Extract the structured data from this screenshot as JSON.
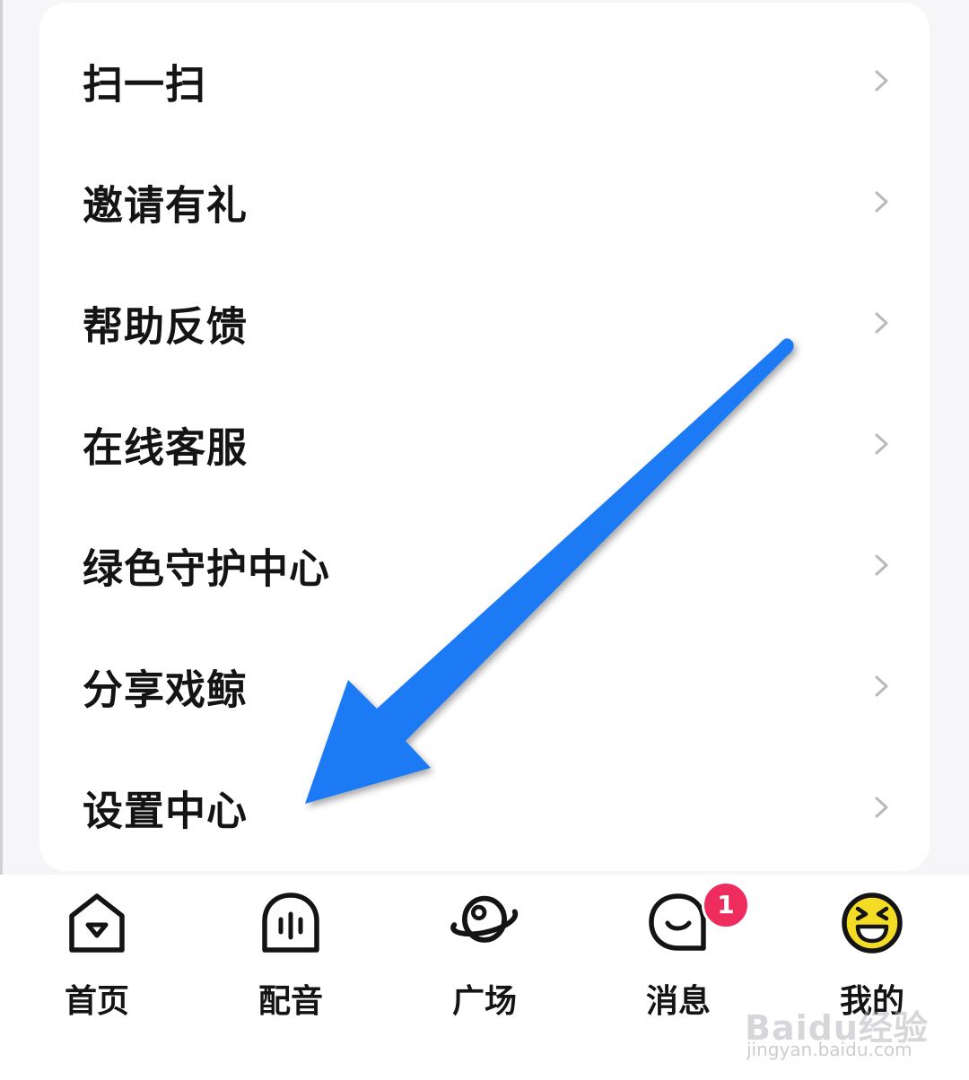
{
  "menu": {
    "items": [
      {
        "label": "扫一扫"
      },
      {
        "label": "邀请有礼"
      },
      {
        "label": "帮助反馈"
      },
      {
        "label": "在线客服"
      },
      {
        "label": "绿色守护中心"
      },
      {
        "label": "分享戏鲸"
      },
      {
        "label": "设置中心"
      }
    ],
    "chevron_icon": "chevron-right-icon"
  },
  "tabbar": {
    "tabs": [
      {
        "label": "首页",
        "icon": "home-icon"
      },
      {
        "label": "配音",
        "icon": "dubbing-ghost-icon"
      },
      {
        "label": "广场",
        "icon": "planet-plaza-icon"
      },
      {
        "label": "消息",
        "icon": "message-bubble-icon"
      },
      {
        "label": "我的",
        "icon": "laughing-face-icon"
      }
    ],
    "message_badge": "1"
  },
  "annotation": {
    "arrow_color": "#1f7af5"
  },
  "watermark": {
    "brand": "Baidu经验",
    "url": "jingyan.baidu.com"
  },
  "colors": {
    "badge": "#ee2d5e",
    "emoji_yellow": "#f4dc24",
    "text": "#141414",
    "chevron": "#b8b8bd"
  }
}
